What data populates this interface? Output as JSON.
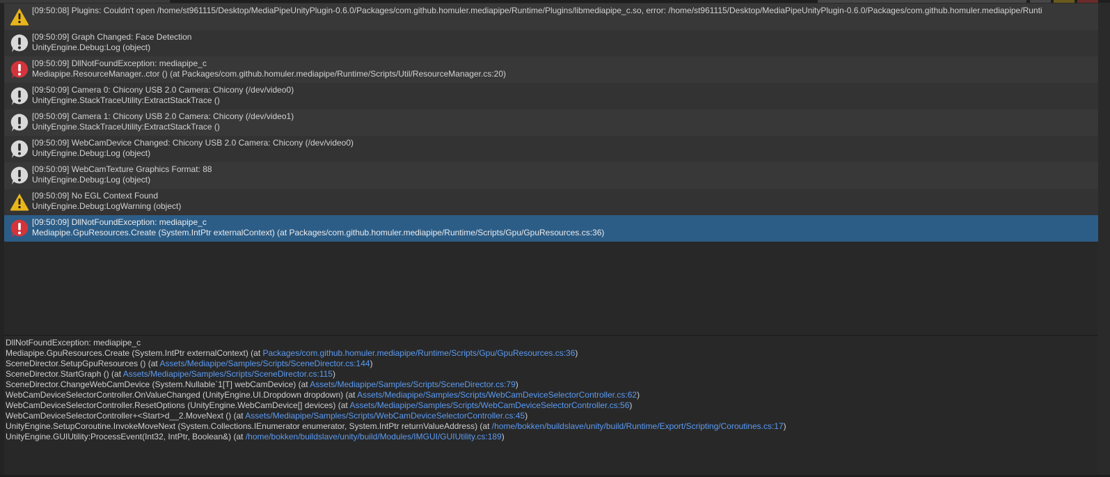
{
  "colors": {
    "warning": "#e8b51a",
    "info": "#d9d9d9",
    "error": "#d3343c",
    "selected_row": "#2c5d87",
    "link": "#5b9bf2"
  },
  "rows": [
    {
      "type": "warning",
      "icon": "warning-icon",
      "line1": "[09:50:08] Plugins: Couldn't open /home/st961115/Desktop/MediaPipeUnityPlugin-0.6.0/Packages/com.github.homuler.mediapipe/Runtime/Plugins/libmediapipe_c.so, error: /home/st961115/Desktop/MediaPipeUnityPlugin-0.6.0/Packages/com.github.homuler.mediapipe/Runti",
      "line2": ""
    },
    {
      "type": "info",
      "icon": "info-icon",
      "line1": "[09:50:09] Graph Changed: Face Detection",
      "line2": "UnityEngine.Debug:Log (object)"
    },
    {
      "type": "error",
      "icon": "error-icon",
      "line1": "[09:50:09] DllNotFoundException: mediapipe_c",
      "line2": "Mediapipe.ResourceManager..ctor () (at Packages/com.github.homuler.mediapipe/Runtime/Scripts/Util/ResourceManager.cs:20)"
    },
    {
      "type": "info",
      "icon": "info-icon",
      "line1": "[09:50:09] Camera 0: Chicony USB 2.0 Camera: Chicony (/dev/video0)",
      "line2": "UnityEngine.StackTraceUtility:ExtractStackTrace ()"
    },
    {
      "type": "info",
      "icon": "info-icon",
      "line1": "[09:50:09] Camera 1: Chicony USB 2.0 Camera: Chicony (/dev/video1)",
      "line2": "UnityEngine.StackTraceUtility:ExtractStackTrace ()"
    },
    {
      "type": "info",
      "icon": "info-icon",
      "line1": "[09:50:09] WebCamDevice Changed: Chicony USB 2.0 Camera: Chicony (/dev/video0)",
      "line2": "UnityEngine.Debug:Log (object)"
    },
    {
      "type": "info",
      "icon": "info-icon",
      "line1": "[09:50:09] WebCamTexture Graphics Format: 88",
      "line2": "UnityEngine.Debug:Log (object)"
    },
    {
      "type": "warning",
      "icon": "warning-icon",
      "line1": "[09:50:09] No EGL Context Found",
      "line2": "UnityEngine.Debug:LogWarning (object)"
    },
    {
      "type": "error",
      "icon": "error-icon",
      "selected": true,
      "line1": "[09:50:09] DllNotFoundException: mediapipe_c",
      "line2": "Mediapipe.GpuResources.Create (System.IntPtr externalContext) (at Packages/com.github.homuler.mediapipe/Runtime/Scripts/Gpu/GpuResources.cs:36)"
    }
  ],
  "detail": {
    "lines": [
      {
        "text": "DllNotFoundException: mediapipe_c",
        "link": "",
        "suffix": ""
      },
      {
        "text": "Mediapipe.GpuResources.Create (System.IntPtr externalContext) (at ",
        "link": "Packages/com.github.homuler.mediapipe/Runtime/Scripts/Gpu/GpuResources.cs:36",
        "suffix": ")"
      },
      {
        "text": "SceneDirector.SetupGpuResources () (at ",
        "link": "Assets/Mediapipe/Samples/Scripts/SceneDirector.cs:144",
        "suffix": ")"
      },
      {
        "text": "SceneDirector.StartGraph () (at ",
        "link": "Assets/Mediapipe/Samples/Scripts/SceneDirector.cs:115",
        "suffix": ")"
      },
      {
        "text": "SceneDirector.ChangeWebCamDevice (System.Nullable`1[T] webCamDevice) (at ",
        "link": "Assets/Mediapipe/Samples/Scripts/SceneDirector.cs:79",
        "suffix": ")"
      },
      {
        "text": "WebCamDeviceSelectorController.OnValueChanged (UnityEngine.UI.Dropdown dropdown) (at ",
        "link": "Assets/Mediapipe/Samples/Scripts/WebCamDeviceSelectorController.cs:62",
        "suffix": ")"
      },
      {
        "text": "WebCamDeviceSelectorController.ResetOptions (UnityEngine.WebCamDevice[] devices) (at ",
        "link": "Assets/Mediapipe/Samples/Scripts/WebCamDeviceSelectorController.cs:56",
        "suffix": ")"
      },
      {
        "text": "WebCamDeviceSelectorController+<Start>d__2.MoveNext () (at ",
        "link": "Assets/Mediapipe/Samples/Scripts/WebCamDeviceSelectorController.cs:45",
        "suffix": ")"
      },
      {
        "text": "UnityEngine.SetupCoroutine.InvokeMoveNext (System.Collections.IEnumerator enumerator, System.IntPtr returnValueAddress) (at ",
        "link": "/home/bokken/buildslave/unity/build/Runtime/Export/Scripting/Coroutines.cs:17",
        "suffix": ")"
      },
      {
        "text": "UnityEngine.GUIUtility:ProcessEvent(Int32, IntPtr, Boolean&) (at ",
        "link": "/home/bokken/buildslave/unity/build/Modules/IMGUI/GUIUtility.cs:189",
        "suffix": ")"
      }
    ]
  }
}
